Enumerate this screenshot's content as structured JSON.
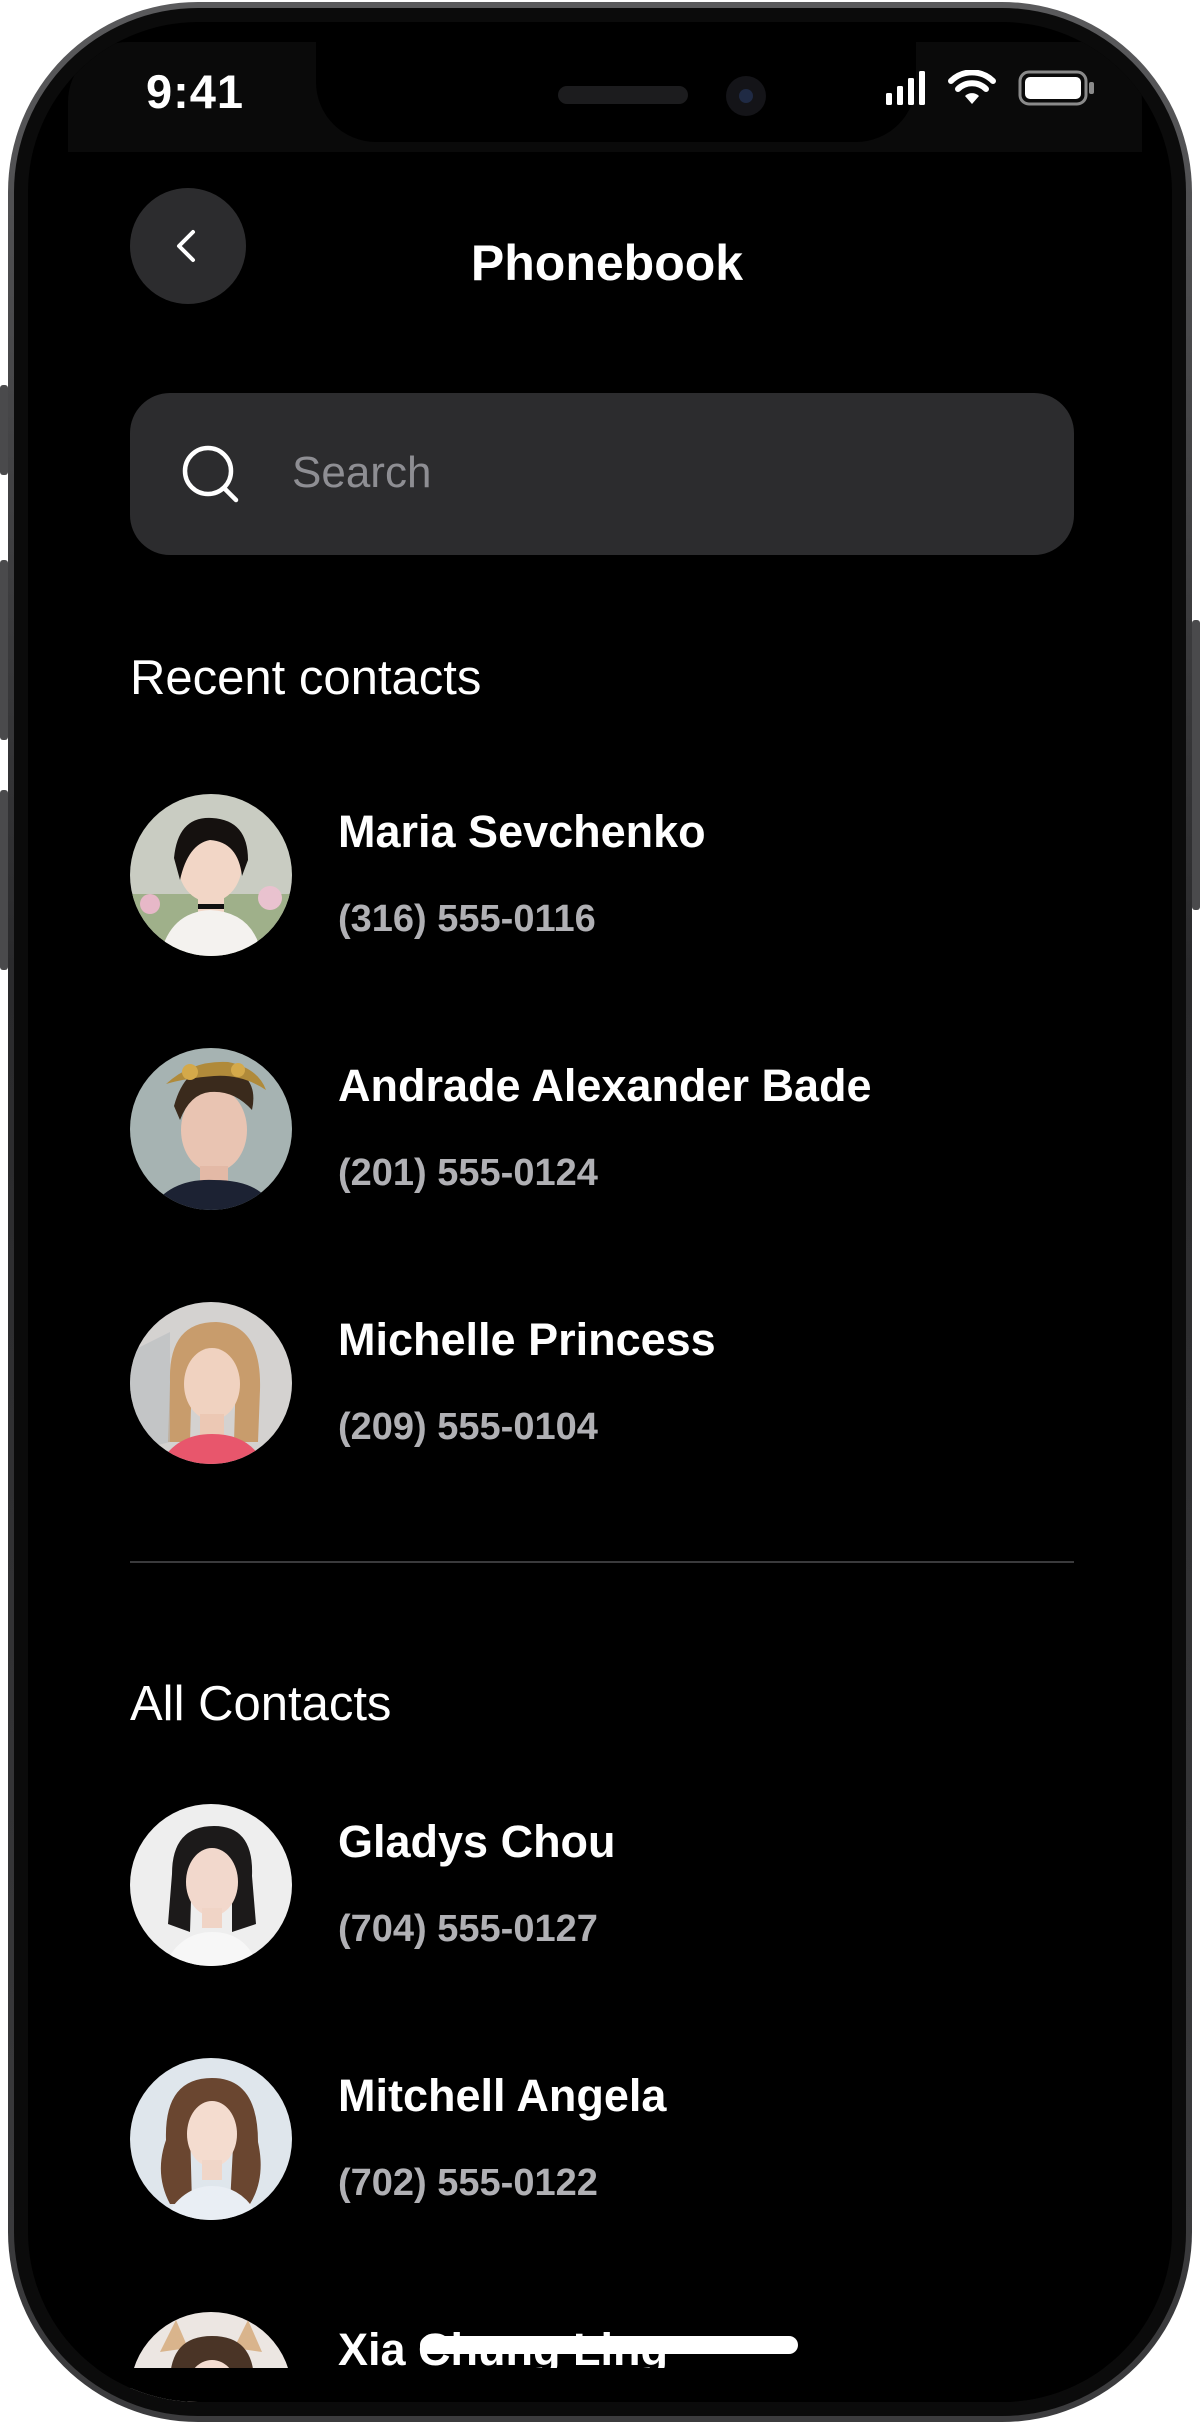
{
  "status_bar": {
    "time": "9:41"
  },
  "header": {
    "title": "Phonebook"
  },
  "search": {
    "placeholder": "Search"
  },
  "sections": {
    "recent_heading": "Recent contacts",
    "all_heading": "All Contacts"
  },
  "recent_contacts": [
    {
      "name": "Maria Sevchenko",
      "phone": "(316) 555-0116"
    },
    {
      "name": "Andrade Alexander Bade",
      "phone": "(201) 555-0124"
    },
    {
      "name": "Michelle Princess",
      "phone": "(209) 555-0104"
    }
  ],
  "all_contacts": [
    {
      "name": "Gladys Chou",
      "phone": "(704) 555-0127"
    },
    {
      "name": "Mitchell Angela",
      "phone": "(702) 555-0122"
    },
    {
      "name": "Xia Chung Ling",
      "phone": ""
    }
  ],
  "colors": {
    "background": "#000000",
    "surface": "#2c2c2e",
    "text_primary": "#ffffff",
    "text_secondary": "#b0b0b4",
    "placeholder": "#8e8e93",
    "divider": "#3a3a3c"
  },
  "icons": [
    "back-chevron-icon",
    "search-icon",
    "cellular-signal-icon",
    "wifi-icon",
    "battery-icon"
  ]
}
